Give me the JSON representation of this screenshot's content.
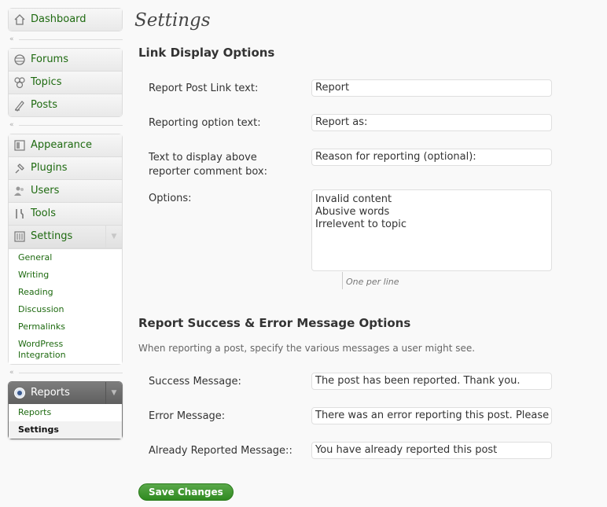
{
  "sidebar": {
    "dashboard": "Dashboard",
    "group1": [
      "Forums",
      "Topics",
      "Posts"
    ],
    "group2": [
      "Appearance",
      "Plugins",
      "Users",
      "Tools",
      "Settings"
    ],
    "settings_sub": [
      "General",
      "Writing",
      "Reading",
      "Discussion",
      "Permalinks",
      "WordPress Integration"
    ],
    "reports": {
      "label": "Reports",
      "sub": [
        "Reports",
        "Settings"
      ]
    }
  },
  "page": {
    "title": "Settings",
    "section1": {
      "heading": "Link Display Options",
      "report_link_label": "Report Post Link text:",
      "report_link_value": "Report",
      "reporting_option_label": "Reporting option text:",
      "reporting_option_value": "Report as:",
      "above_box_label_line1": "Text to display above",
      "above_box_label_line2": "reporter comment box:",
      "above_box_value": "Reason for reporting (optional):",
      "options_label": "Options:",
      "options_value": "Invalid content\nAbusive words\nIrrelevent to topic",
      "options_hint": "One per line"
    },
    "section2": {
      "heading": "Report Success & Error Message Options",
      "description": "When reporting a post, specify the various messages a user might see.",
      "success_label": "Success Message:",
      "success_value": "The post has been reported. Thank you.",
      "error_label": "Error Message:",
      "error_value": "There was an error reporting this post. Please try again.",
      "already_label": "Already Reported Message::",
      "already_value": "You have already reported this post"
    },
    "save_label": "Save Changes"
  }
}
